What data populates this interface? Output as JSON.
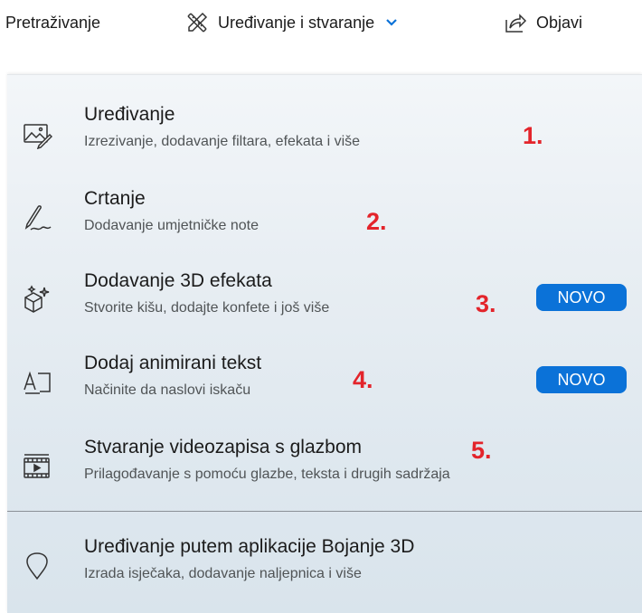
{
  "toolbar": {
    "search_label": "Pretraživanje",
    "edit_create_label": "Uređivanje i stvaranje",
    "publish_label": "Objavi"
  },
  "menu": {
    "items": [
      {
        "title": "Uređivanje",
        "description": "Izrezivanje, dodavanje filtara, efekata i više",
        "annotation": "1.",
        "icon": "photo-edit-icon"
      },
      {
        "title": "Crtanje",
        "description": "Dodavanje umjetničke note",
        "annotation": "2.",
        "icon": "pen-draw-icon"
      },
      {
        "title": "Dodavanje 3D efekata",
        "description": "Stvorite kišu, dodajte konfete i još više",
        "annotation": "3.",
        "badge": "NOVO",
        "icon": "cube-sparkle-icon"
      },
      {
        "title": "Dodaj animirani tekst",
        "description": "Načinite da naslovi iskaču",
        "annotation": "4.",
        "badge": "NOVO",
        "icon": "animated-text-icon"
      },
      {
        "title": "Stvaranje videozapisa s glazbom",
        "description": "Prilagođavanje s pomoću glazbe, teksta i drugih sadržaja",
        "annotation": "5.",
        "icon": "video-music-icon"
      },
      {
        "title": "Uređivanje putem aplikacije Bojanje 3D",
        "description": "Izrada isječaka, dodavanje naljepnica i više",
        "icon": "paint3d-icon"
      }
    ]
  },
  "colors": {
    "annotation": "#e3242b",
    "badge_bg": "#0b72d8",
    "chevron": "#0b72d8"
  }
}
